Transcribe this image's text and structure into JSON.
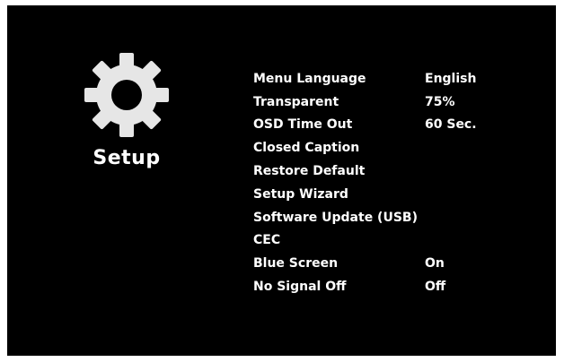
{
  "screen": {
    "title": "Setup",
    "icon": "gear-icon",
    "background": "#000000",
    "text_color": "#ffffff"
  },
  "menu": {
    "items": [
      {
        "label": "Menu Language",
        "value": "English"
      },
      {
        "label": "Transparent",
        "value": "75%"
      },
      {
        "label": "OSD Time Out",
        "value": "60 Sec."
      },
      {
        "label": "Closed Caption",
        "value": ""
      },
      {
        "label": "Restore Default",
        "value": ""
      },
      {
        "label": "Setup Wizard",
        "value": ""
      },
      {
        "label": "Software Update (USB)",
        "value": ""
      },
      {
        "label": "CEC",
        "value": ""
      },
      {
        "label": "Blue Screen",
        "value": "On"
      },
      {
        "label": "No Signal Off",
        "value": "Off"
      }
    ]
  }
}
